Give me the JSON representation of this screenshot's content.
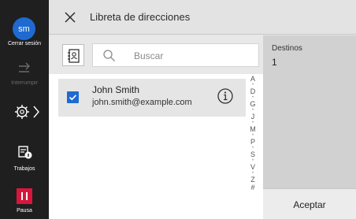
{
  "rail": {
    "avatar_initials": "sm",
    "logout_label": "Cerrar sesión",
    "interrupt_label": "Interrumpir",
    "jobs_label": "Trabajos",
    "pause_label": "Pausa"
  },
  "header": {
    "title": "Libreta de direcciones"
  },
  "search": {
    "placeholder": "Buscar"
  },
  "contacts": [
    {
      "name": "John Smith",
      "email": "john.smith@example.com",
      "selected": true
    }
  ],
  "alpha_index": [
    "A",
    "D",
    "G",
    "J",
    "M",
    "P",
    "S",
    "V",
    "Z",
    "#"
  ],
  "destinations": {
    "label": "Destinos",
    "count": "1"
  },
  "accept_label": "Aceptar",
  "colors": {
    "accent": "#1f6ad1",
    "pause": "#d8163c",
    "rail": "#1f1f1f"
  }
}
